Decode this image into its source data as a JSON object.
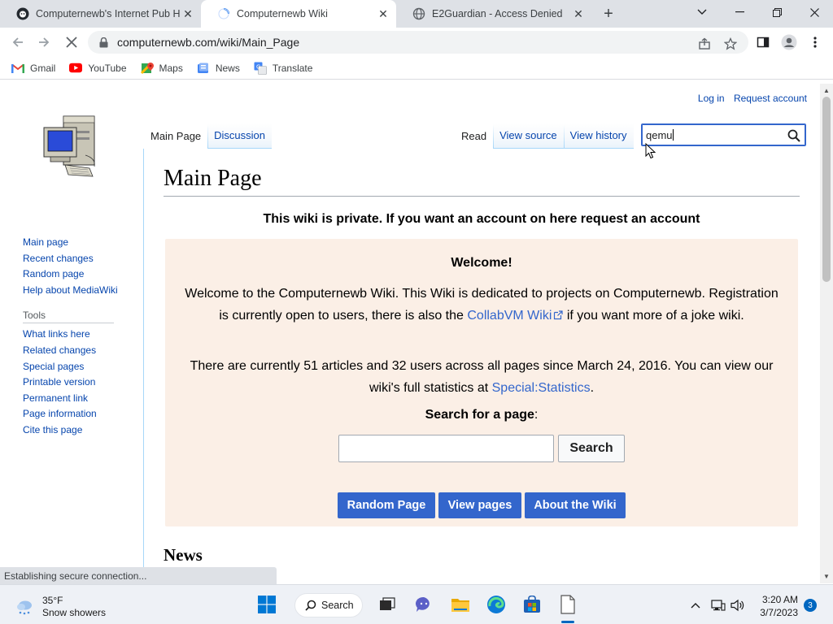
{
  "browser": {
    "tabs": [
      {
        "title": "Computernewb's Internet Pub Hu",
        "icon": "github-octocat-icon"
      },
      {
        "title": "Computernewb Wiki",
        "icon": "loading-spinner-icon"
      },
      {
        "title": "E2Guardian - Access Denied",
        "icon": "globe-icon"
      }
    ],
    "url": "computernewb.com/wiki/Main_Page",
    "bookmarks": [
      {
        "label": "Gmail",
        "icon": "gmail-icon"
      },
      {
        "label": "YouTube",
        "icon": "youtube-icon"
      },
      {
        "label": "Maps",
        "icon": "maps-icon"
      },
      {
        "label": "News",
        "icon": "news-icon"
      },
      {
        "label": "Translate",
        "icon": "translate-icon"
      }
    ],
    "status_text": "Establishing secure connection..."
  },
  "wiki": {
    "personal": {
      "login": "Log in",
      "request": "Request account"
    },
    "namespace_tabs": [
      "Main Page",
      "Discussion"
    ],
    "view_tabs": [
      "Read",
      "View source",
      "View history"
    ],
    "search_value": "qemu",
    "sidebar": {
      "nav": [
        "Main page",
        "Recent changes",
        "Random page",
        "Help about MediaWiki"
      ],
      "tools_heading": "Tools",
      "tools": [
        "What links here",
        "Related changes",
        "Special pages",
        "Printable version",
        "Permanent link",
        "Page information",
        "Cite this page"
      ]
    },
    "heading": "Main Page",
    "private_notice": "This wiki is private. If you want an account on here request an account",
    "welcome": {
      "title": "Welcome!",
      "p1_a": "Welcome to the Computernewb Wiki. This Wiki is dedicated to projects on Computernewb. Registration is currently open to users, there is also the ",
      "p1_link": "CollabVM Wiki",
      "p1_b": " if you want more of a joke wiki.",
      "p2_a": "There are currently 51 articles and 32 users across all pages since March 24, 2016. You can view our wiki's full statistics at ",
      "p2_link": "Special:Statistics",
      "p2_b": ".",
      "search_label": "Search for a page",
      "search_colon": ":",
      "search_button": "Search",
      "buttons": [
        "Random Page",
        "View pages",
        "About the Wiki"
      ]
    },
    "news_heading": "News"
  },
  "taskbar": {
    "weather_temp": "35°F",
    "weather_desc": "Snow showers",
    "search_label": "Search",
    "time": "3:20 AM",
    "date": "3/7/2023",
    "notifications": "3"
  }
}
